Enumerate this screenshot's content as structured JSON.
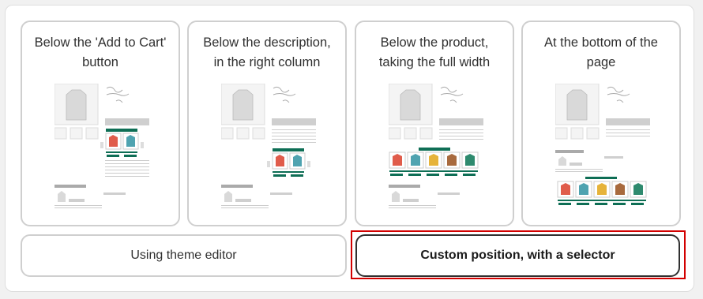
{
  "options": [
    {
      "label": "Below the 'Add to Cart' button"
    },
    {
      "label": "Below the description, in the right column"
    },
    {
      "label": "Below the product, taking the full width"
    },
    {
      "label": "At the bottom of the page"
    }
  ],
  "buttons": {
    "theme_editor": "Using theme editor",
    "custom_selector": "Custom position, with a selector"
  },
  "colors": {
    "accent_green": "#0e6e55",
    "selected_border": "#303030",
    "highlight_red": "#d20000",
    "card_border": "#cfcfcf",
    "hoodie_colors": [
      "#e05c4b",
      "#4fa3b0",
      "#e6b33a",
      "#a86a3e",
      "#2e8a6e"
    ]
  }
}
